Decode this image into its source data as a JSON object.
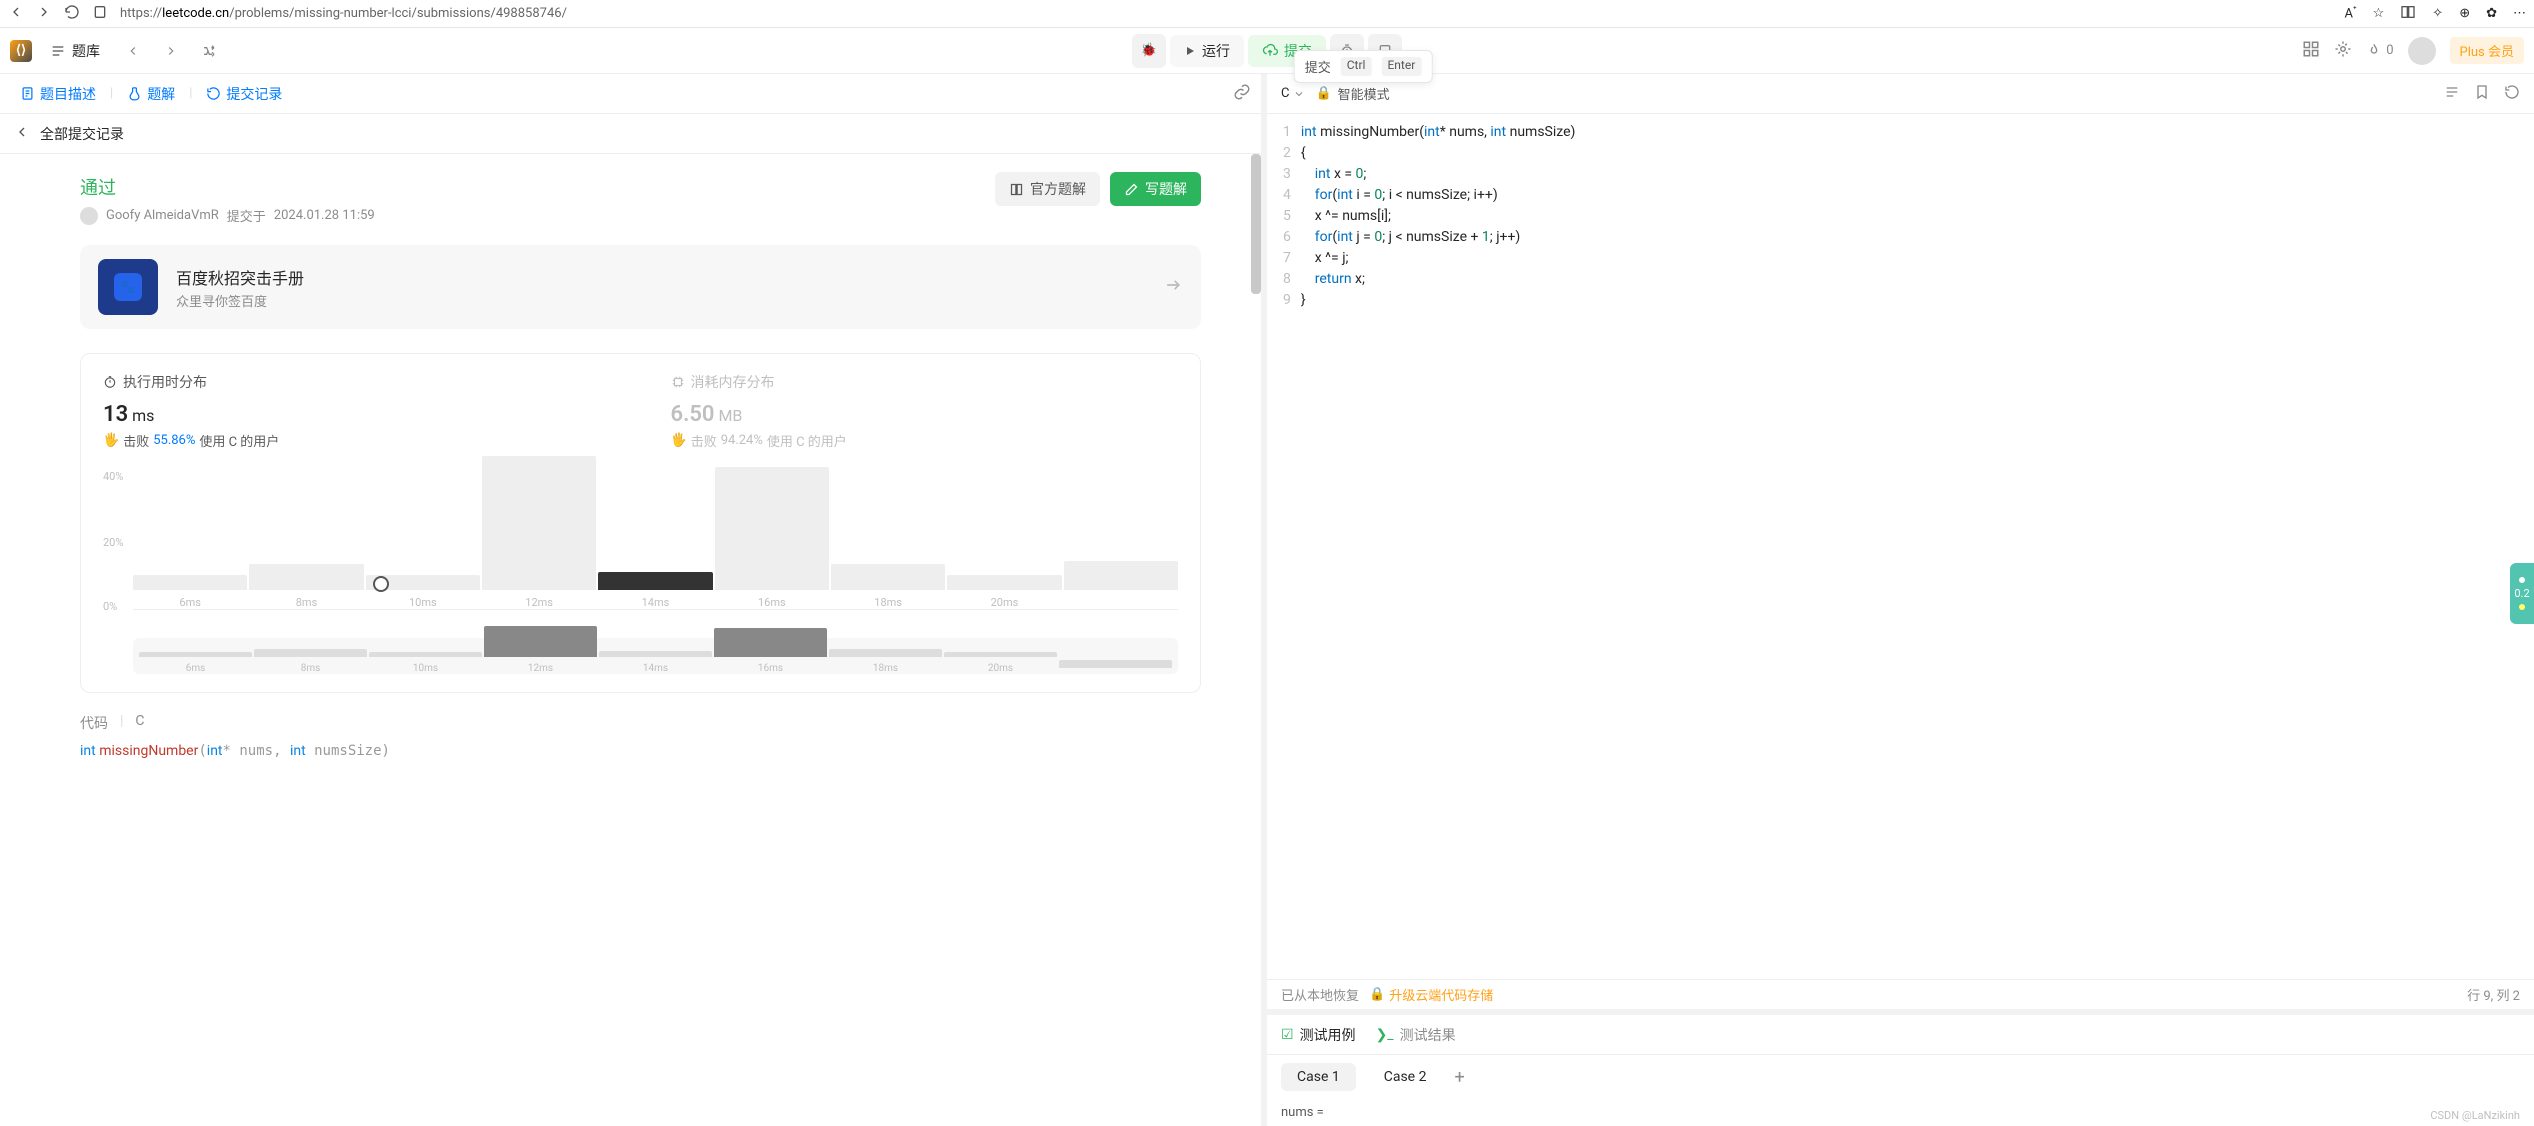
{
  "browser": {
    "url_prefix": "https://",
    "url_host": "leetcode.cn",
    "url_path": "/problems/missing-number-lcci/submissions/498858746/"
  },
  "toolbar": {
    "library": "题库",
    "run": "运行",
    "submit": "提交",
    "streak": "0",
    "plus": "Plus 会员"
  },
  "tooltip": {
    "label": "提交",
    "key1": "Ctrl",
    "key2": "Enter"
  },
  "left_tabs": {
    "description": "题目描述",
    "solution": "题解",
    "submissions": "提交记录"
  },
  "sub_header": {
    "title": "全部提交记录"
  },
  "submission": {
    "status": "通过",
    "user": "Goofy AlmeidaVmR",
    "submitted_at_label": "提交于",
    "submitted_at": "2024.01.28 11:59",
    "official": "官方题解",
    "write": "写题解"
  },
  "promo": {
    "title": "百度秋招突击手册",
    "subtitle": "众里寻你签百度"
  },
  "stats": {
    "runtime_title": "执行用时分布",
    "memory_title": "消耗内存分布",
    "runtime_value": "13",
    "runtime_unit": "ms",
    "memory_value": "6.50",
    "memory_unit": "MB",
    "beat_label": "击败",
    "runtime_pct": "55.86%",
    "memory_pct": "94.24%",
    "users_label": "使用 C 的用户"
  },
  "chart_data": {
    "type": "bar",
    "ylabel_top": "40%",
    "ylabel_mid": "20%",
    "ylabel_low": "0%",
    "categories": [
      "6ms",
      "8ms",
      "10ms",
      "12ms",
      "14ms",
      "16ms",
      "18ms",
      "20ms"
    ],
    "values": [
      3,
      6,
      3,
      36,
      4,
      33,
      6,
      3,
      7
    ],
    "highlight_index": 4,
    "mini_categories": [
      "6ms",
      "8ms",
      "10ms",
      "12ms",
      "14ms",
      "16ms",
      "18ms",
      "20ms"
    ]
  },
  "code_section": {
    "label": "代码",
    "lang": "C",
    "preview_fn": "missingNumber",
    "preview_sig_rest": "int* nums, int numsSize)"
  },
  "editor": {
    "lang": "C",
    "smart_mode": "智能模式",
    "restored": "已从本地恢复",
    "cloud_upgrade": "升级云端代码存储",
    "cursor": "行 9, 列 2",
    "lines": [
      "int missingNumber(int* nums, int numsSize)",
      "{",
      "    int x = 0;",
      "    for(int i = 0; i < numsSize; i++)",
      "    x ^= nums[i];",
      "    for(int j = 0; j < numsSize + 1; j++)",
      "    x ^= j;",
      "    return x;",
      "}"
    ]
  },
  "test": {
    "cases_tab": "测试用例",
    "results_tab": "测试结果",
    "case1": "Case 1",
    "case2": "Case 2",
    "input_label": "nums ="
  },
  "footer": "CSDN @LaNzikinh",
  "side_widget": "0.2"
}
